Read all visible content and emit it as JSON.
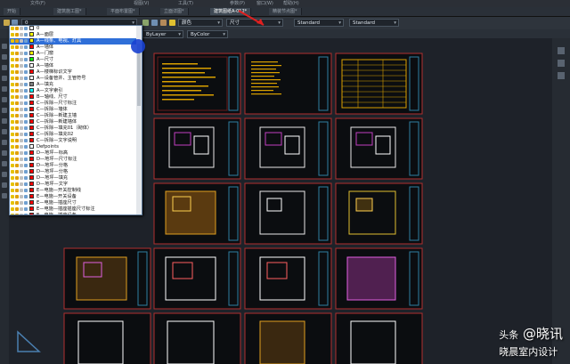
{
  "menu": {
    "items": [
      "文件(F)",
      "视图(V)",
      "工具(T)",
      "参数(P)",
      "窗口(W)",
      "帮助(H)"
    ]
  },
  "tabs": [
    {
      "label": "开始"
    },
    {
      "label": "建筑施工图*"
    },
    {
      "label": "平面布置图*"
    },
    {
      "label": "立面详图*"
    },
    {
      "label": "建筑图纸A-012*",
      "active": true
    },
    {
      "label": "精装节点图*"
    }
  ],
  "toolbar": {
    "layer_select": "0",
    "color_select": "颜色",
    "linetype_select": "尺寸",
    "style_select_1": "Standard",
    "style_select_2": "Standard",
    "bylayer": "ByLayer",
    "bycolor": "ByColor"
  },
  "layers": [
    {
      "name": "0",
      "color": "#ffffff"
    },
    {
      "name": "A—面层",
      "color": "#ffff00"
    },
    {
      "name": "A—线条、电视、灯具",
      "color": "#ffff00",
      "selected": true
    },
    {
      "name": "A—墙体",
      "color": "#ff0000"
    },
    {
      "name": "A—门窗",
      "color": "#ffff00"
    },
    {
      "name": "A—尺寸",
      "color": "#00ff00"
    },
    {
      "name": "A—墙体",
      "color": "#ffffff"
    },
    {
      "name": "A—楼梯标识文字",
      "color": "#ff0000"
    },
    {
      "name": "A—设备管井、主管符号",
      "color": "#ffffff"
    },
    {
      "name": "A—填充",
      "color": "#808080"
    },
    {
      "name": "A—文字索引",
      "color": "#00ffff"
    },
    {
      "name": "B—轴线、尺寸",
      "color": "#ff0000"
    },
    {
      "name": "C—拆除—尺寸标注",
      "color": "#ff0000"
    },
    {
      "name": "C—拆除—墙体",
      "color": "#ff0000"
    },
    {
      "name": "C—拆除—新建主墙",
      "color": "#ff0000"
    },
    {
      "name": "C—拆除—新建墙体",
      "color": "#ff0000"
    },
    {
      "name": "C—拆除—填充01（砌体）",
      "color": "#ff0000"
    },
    {
      "name": "C—拆除—填充02",
      "color": "#ff0000"
    },
    {
      "name": "C—拆除—文字说明",
      "color": "#ff0000"
    },
    {
      "name": "Defpoints",
      "color": "#ffffff"
    },
    {
      "name": "D—地坪—标高",
      "color": "#ff0000"
    },
    {
      "name": "D—地坪—尺寸标注",
      "color": "#ff0000"
    },
    {
      "name": "D—地坪—分格",
      "color": "#ff0000"
    },
    {
      "name": "D—地坪—分格",
      "color": "#ff0000"
    },
    {
      "name": "D—地坪—填充",
      "color": "#ff0000"
    },
    {
      "name": "D—地坪—文字",
      "color": "#ff0000"
    },
    {
      "name": "E—电施—开关控制线",
      "color": "#ff0000"
    },
    {
      "name": "E—电施—开关设备",
      "color": "#ff0000"
    },
    {
      "name": "E—电施—插座尺寸",
      "color": "#ff0000"
    },
    {
      "name": "E—电施—插座插座尺寸标注",
      "color": "#ff0000"
    },
    {
      "name": "E—电施—插座设备",
      "color": "#ff0000"
    },
    {
      "name": "E—电施—插座插座尺寸标注",
      "color": "#ff0000"
    },
    {
      "name": "E—文字—索引图例",
      "color": "#ffffff"
    }
  ],
  "watermark": {
    "prefix": "头条",
    "handle": "@晓讯",
    "subtitle": "晓晨室内设计"
  }
}
